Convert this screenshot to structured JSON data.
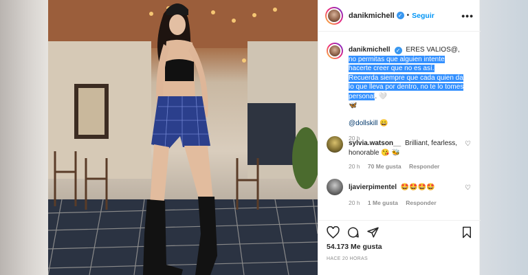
{
  "post": {
    "username": "danikmichell",
    "follow_label": "Seguir",
    "dot": "•",
    "more": "•••"
  },
  "caption": {
    "username": "danikmichell",
    "text_plain": "ERES VALIOS@,",
    "text_selected": "no permitas que alguien intente hacerte creer que no es así. Recuerda siempre que cada quien da lo que lleva por dentro, no te lo tomes personal",
    "text_end": ". 🤍",
    "emoji_line": "🦋",
    "mention": "@dollskill",
    "mention_emoji": "😄",
    "time": "20 h"
  },
  "comments": [
    {
      "username": "sylvia.watson__",
      "text": "Brilliant, fearless, honorable 😘 🐝",
      "time": "20 h",
      "likes": "70 Me gusta",
      "reply": "Responder"
    },
    {
      "username": "ljavierpimentel",
      "text": "🤩🤩🤩🤩",
      "time": "20 h",
      "likes": "1 Me gusta",
      "reply": "Responder"
    }
  ],
  "footer": {
    "likes": "54.173 Me gusta",
    "time_ago": "HACE 20 HORAS"
  },
  "icons": [
    "heart-icon",
    "comment-icon",
    "share-icon",
    "bookmark-icon",
    "verified-icon",
    "more-icon"
  ]
}
